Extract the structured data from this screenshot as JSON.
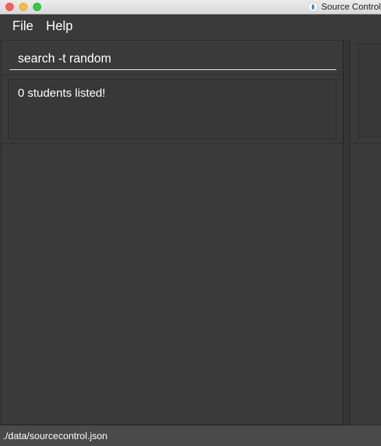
{
  "window": {
    "title": "Source Control"
  },
  "menu": {
    "items": [
      {
        "label": "File"
      },
      {
        "label": "Help"
      }
    ]
  },
  "command": {
    "value": "search -t random"
  },
  "result": {
    "message": "0 students listed!"
  },
  "status": {
    "file_path": "./data/sourcecontrol.json"
  },
  "colors": {
    "background": "#3a3a3a",
    "text": "#ffffff",
    "border": "#2a2a2a",
    "status_bar": "#4a4a4a"
  },
  "icons": {
    "app": "source-control-app-icon",
    "window_controls": [
      "close-icon",
      "minimize-icon",
      "maximize-icon"
    ]
  }
}
